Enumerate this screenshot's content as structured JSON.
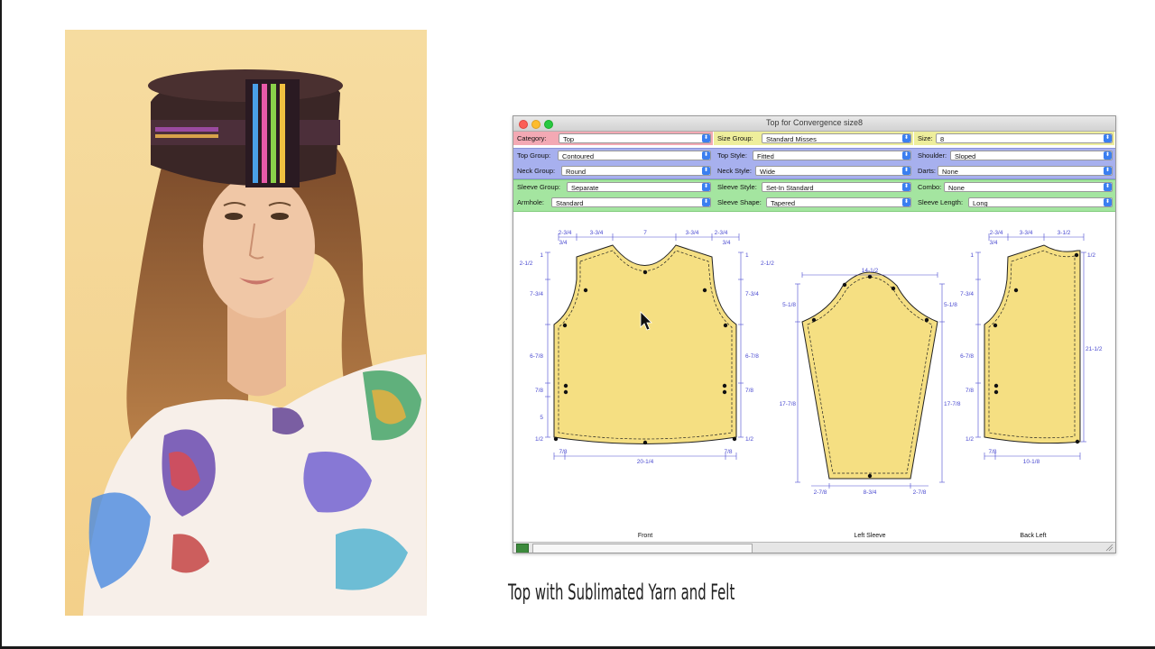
{
  "window": {
    "title": "Top for Convergence size8"
  },
  "fields": {
    "category": {
      "label": "Category:",
      "value": "Top"
    },
    "size_group": {
      "label": "Size Group:",
      "value": "Standard Misses"
    },
    "size": {
      "label": "Size:",
      "value": "8"
    },
    "top_group": {
      "label": "Top Group:",
      "value": "Contoured"
    },
    "top_style": {
      "label": "Top Style:",
      "value": "Fitted"
    },
    "shoulder": {
      "label": "Shoulder:",
      "value": "Sloped"
    },
    "neck_group": {
      "label": "Neck Group:",
      "value": "Round"
    },
    "neck_style": {
      "label": "Neck Style:",
      "value": "Wide"
    },
    "darts": {
      "label": "Darts:",
      "value": "None"
    },
    "sleeve_group": {
      "label": "Sleeve Group:",
      "value": "Separate"
    },
    "sleeve_style": {
      "label": "Sleeve Style:",
      "value": "Set-In Standard"
    },
    "combo": {
      "label": "Combo:",
      "value": "None"
    },
    "armhole": {
      "label": "Armhole:",
      "value": "Standard"
    },
    "sleeve_shape": {
      "label": "Sleeve Shape:",
      "value": "Tapered"
    },
    "sleeve_length": {
      "label": "Sleeve Length:",
      "value": "Long"
    }
  },
  "pieces": {
    "front": {
      "label": "Front",
      "dims": {
        "top_a": "2-3/4",
        "top_b": "3-3/4",
        "top_c": "7",
        "top_d": "3-3/4",
        "top_e": "2-3/4",
        "small_l": "3/4",
        "small_r": "3/4",
        "left_1": "2-1/2",
        "left_2": "1",
        "left_3": "7-3/4",
        "left_4": "6-7/8",
        "left_5": "7/8",
        "left_6": "5",
        "left_7": "1/2",
        "right_1": "1",
        "right_2": "2-1/2",
        "right_3": "7-3/4",
        "right_4": "6-7/8",
        "right_5": "7/8",
        "right_6": "1/2",
        "bottom_l": "7/8",
        "bottom_c": "20-1/4",
        "bottom_r": "7/8"
      }
    },
    "sleeve": {
      "label": "Left Sleeve",
      "dims": {
        "top": "14-1/2",
        "left_1": "5-1/8",
        "left_2": "17-7/8",
        "right_1": "5-1/8",
        "right_2": "17-7/8",
        "bottom_l": "2-7/8",
        "bottom_c": "8-3/4",
        "bottom_r": "2-7/8"
      }
    },
    "back": {
      "label": "Back Left",
      "dims": {
        "top_a": "2-3/4",
        "top_b": "3-3/4",
        "top_c": "3-1/2",
        "small": "3/4",
        "left_1": "1",
        "left_2": "7-3/4",
        "left_3": "6-7/8",
        "left_4": "7/8",
        "left_5": "1/2",
        "right_1": "1/2",
        "right_2": "21-1/2",
        "bottom_l": "7/8",
        "bottom_c": "10-1/8"
      }
    }
  },
  "caption": "Top with Sublimated Yarn and Felt",
  "colors": {
    "piece_fill": "#f5df82",
    "dimension_line": "#4a4ad0",
    "band_pink": "#f3a9b4",
    "band_yellow": "#eeee9c",
    "band_blue": "#a7b0ee",
    "band_green": "#a4e5a0"
  },
  "icons": {
    "cursor": "arrow-cursor-icon",
    "status": "grid-icon"
  }
}
